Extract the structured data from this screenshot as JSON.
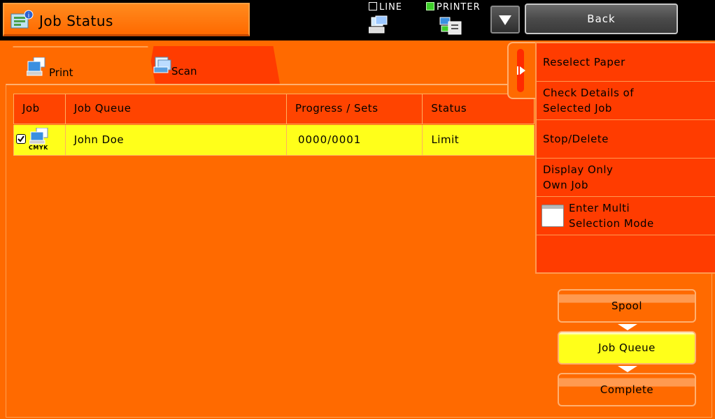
{
  "header": {
    "title": "Job Status",
    "title_icon": "job-status-icon",
    "modes": [
      {
        "label": "LINE",
        "checked": false,
        "icon": "fax-line-icon"
      },
      {
        "label": "PRINTER",
        "checked": true,
        "icon": "printer-mode-icon"
      }
    ],
    "menu_icon": "triangle-down-icon",
    "back_label": "Back"
  },
  "tabs": [
    {
      "label": "Print",
      "icon": "print-icon",
      "active": true
    },
    {
      "label": "Scan",
      "icon": "scan-icon",
      "active": false
    }
  ],
  "table": {
    "columns": [
      "Job",
      "Job Queue",
      "Progress / Sets",
      "Status"
    ],
    "rows": [
      {
        "selected": true,
        "job_icon": "print-job-icon",
        "color_mode": "CMYK",
        "queue": "John Doe",
        "progress": "0000/0001",
        "status": "Limit"
      }
    ]
  },
  "side_menu": {
    "toggle_icon": "collapse-arrow-icon",
    "items": [
      {
        "label": "Reselect Paper"
      },
      {
        "label": "Check Details of\nSelected Job"
      },
      {
        "label": "Stop/Delete"
      },
      {
        "label": "Display Only\nOwn Job"
      },
      {
        "label": "Enter Multi\nSelection Mode",
        "icon": "multi-selection-icon"
      }
    ]
  },
  "flow": [
    {
      "label": "Spool",
      "active": false
    },
    {
      "label": "Job Queue",
      "active": true
    },
    {
      "label": "Complete",
      "active": false
    }
  ],
  "colors": {
    "accent": "#ff6a00",
    "tab_inactive": "#ff3c00",
    "selected_row": "#ffff1a",
    "header_bg": "#000000"
  }
}
